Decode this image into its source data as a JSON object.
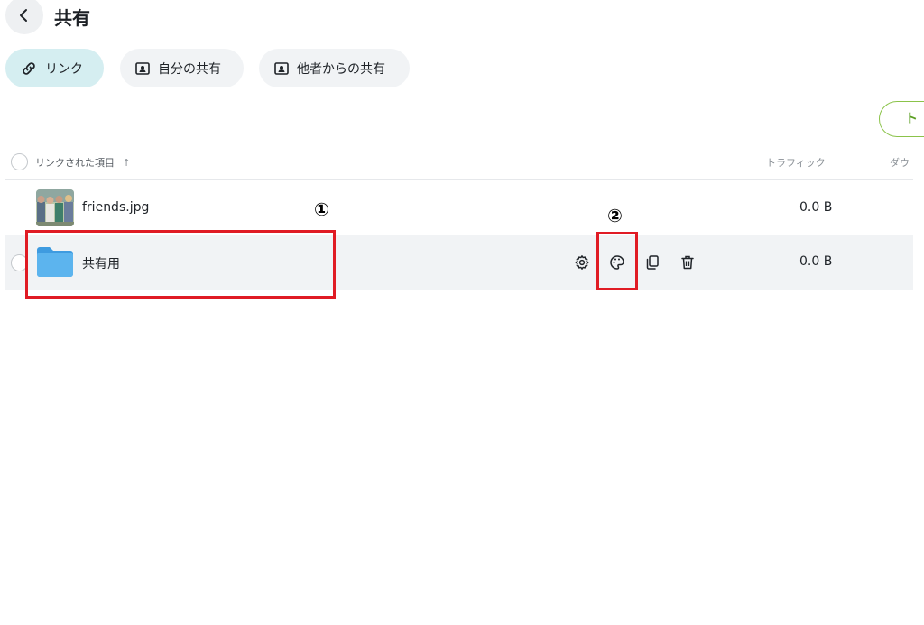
{
  "header": {
    "title": "共有"
  },
  "tabs": [
    {
      "label": "リンク",
      "active": true
    },
    {
      "label": "自分の共有",
      "active": false
    },
    {
      "label": "他者からの共有",
      "active": false
    }
  ],
  "partial_button": {
    "label": "ト"
  },
  "table": {
    "columns": {
      "name": "リンクされた項目",
      "sort_indicator": "↑",
      "traffic": "トラフィック",
      "download": "ダウ"
    },
    "rows": [
      {
        "name": "friends.jpg",
        "traffic": "0.0 B",
        "type": "image"
      },
      {
        "name": "共有用",
        "traffic": "0.0 B",
        "type": "folder"
      }
    ]
  },
  "annotations": [
    {
      "label": "①"
    },
    {
      "label": "②"
    }
  ],
  "colors": {
    "accent_tab": "#d5eef1",
    "folder": "#4aa8e8",
    "annotation": "#e01b24",
    "green": "#8bc34a"
  },
  "icons": [
    "chevron-left-icon",
    "link-icon",
    "user-folder-icon",
    "gear-icon",
    "palette-icon",
    "copy-icon",
    "trash-icon",
    "folder-icon"
  ]
}
